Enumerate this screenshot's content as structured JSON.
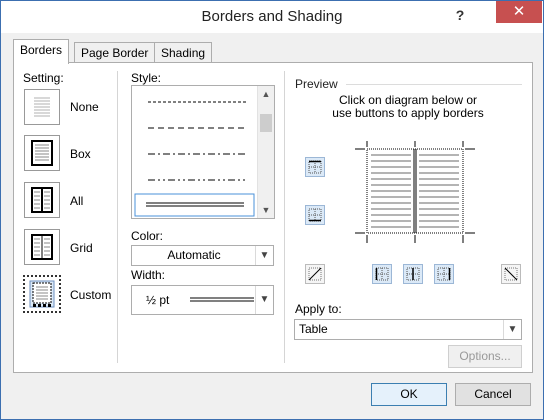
{
  "window": {
    "title": "Borders and Shading",
    "help_label": "?",
    "close_label": "✕"
  },
  "tabs": [
    {
      "label": "Borders",
      "active": true
    },
    {
      "label": "Page Border",
      "active": false
    },
    {
      "label": "Shading",
      "active": false
    }
  ],
  "setting": {
    "label": "Setting:",
    "options": [
      {
        "label": "None",
        "icon": "none-setting-icon"
      },
      {
        "label": "Box",
        "icon": "box-setting-icon"
      },
      {
        "label": "All",
        "icon": "all-setting-icon"
      },
      {
        "label": "Grid",
        "icon": "grid-setting-icon"
      },
      {
        "label": "Custom",
        "icon": "custom-setting-icon",
        "selected": true
      }
    ]
  },
  "style": {
    "label": "Style:",
    "lines": [
      "dashed-short",
      "dashed-long",
      "dash-dot",
      "dash-dot-dot",
      "double"
    ],
    "selected": "double"
  },
  "color": {
    "label": "Color:",
    "value": "Automatic"
  },
  "width": {
    "label": "Width:",
    "value": "½ pt"
  },
  "preview": {
    "label": "Preview",
    "instructions_line1": "Click on diagram below or",
    "instructions_line2": "use buttons to apply borders"
  },
  "apply_to": {
    "label": "Apply to:",
    "value": "Table"
  },
  "buttons": {
    "options": "Options...",
    "ok": "OK",
    "cancel": "Cancel"
  }
}
